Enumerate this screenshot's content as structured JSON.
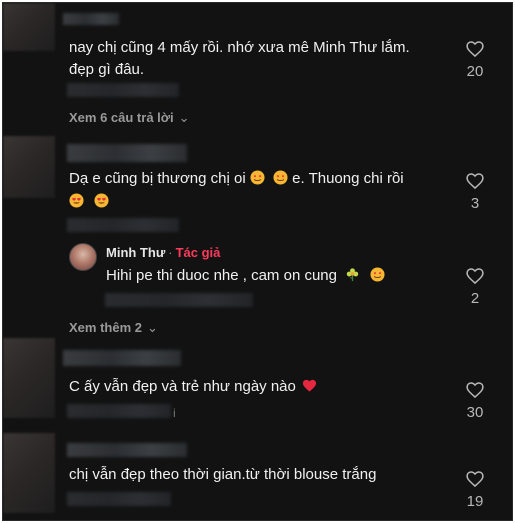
{
  "comments": [
    {
      "text_line1": "nay chị cũng 4 mấy rồi. nhớ xưa mê Minh Thư lắm.",
      "text_line2": "đẹp gì đâu.",
      "likes": "20",
      "view_replies": "Xem 6 câu trả lời"
    },
    {
      "text_prefix": "Dạ e cũng bị thương chị oi",
      "text_suffix": " e. Thuong chi rồi",
      "likes": "3",
      "view_more": "Xem thêm 2"
    },
    {
      "text": "C ấy vẫn đẹp và trẻ như ngày nào",
      "likes": "30"
    },
    {
      "text": "chị vẫn đẹp theo thời gian.từ thời blouse trắng",
      "likes": "19"
    }
  ],
  "reply": {
    "author": "Minh Thư",
    "separator": "·",
    "author_tag": "Tác giả",
    "text": "Hihi pe thi duoc nhe , cam on cung ",
    "likes": "2"
  },
  "misc": {
    "stray_mark": "i"
  },
  "colors": {
    "background": "#121212",
    "author_tag": "#ff3b5c",
    "heart_red": "#e5283f"
  },
  "icons": [
    "heart-outline-icon",
    "chevron-down-icon",
    "smiling-hearts-emoji",
    "heart-eyes-emoji",
    "flower-emoji",
    "red-heart-emoji"
  ]
}
